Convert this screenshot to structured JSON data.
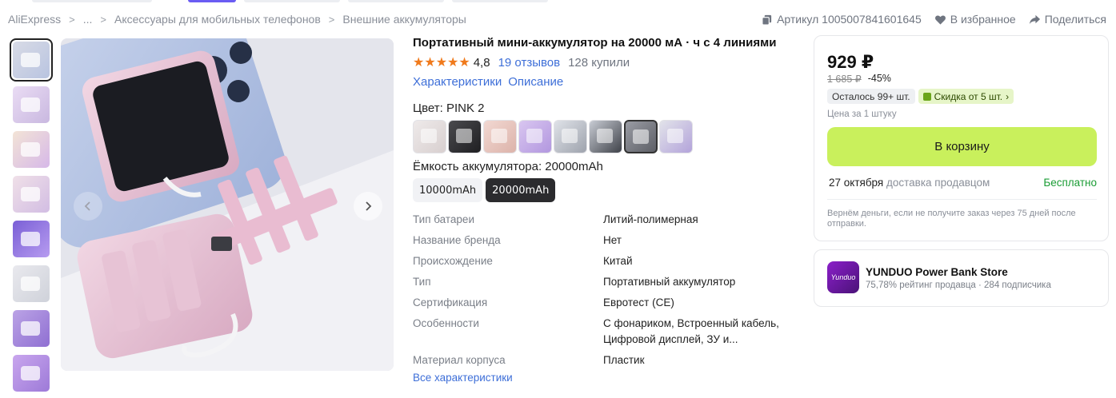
{
  "breadcrumb": {
    "items": [
      "AliExpress",
      "...",
      "Аксессуары для мобильных телефонов",
      "Внешние аккумуляторы"
    ],
    "separator": ">"
  },
  "top_actions": {
    "sku": "Артикул 1005007841601645",
    "favorite": "В избранное",
    "share": "Поделиться"
  },
  "gallery": {
    "thumbnail_count": 8,
    "selected_index": 0,
    "prev_icon": "chevron-left-icon",
    "next_icon": "chevron-right-icon"
  },
  "product": {
    "title": "Портативный мини-аккумулятор на 20000 мА · ч с 4 линиями",
    "stars": "★★★★★",
    "rating": "4,8",
    "reviews": "19 отзывов",
    "bought": "128 купили",
    "tab_specs": "Характеристики",
    "tab_description": "Описание",
    "color_label": "Цвет: PINK 2",
    "color_swatch_count": 8,
    "color_selected_index": 6,
    "capacity_label": "Ёмкость аккумулятора: 20000mAh",
    "capacities": [
      "10000mAh",
      "20000mAh"
    ],
    "capacity_selected": "20000mAh"
  },
  "specs": [
    {
      "key": "Тип батареи",
      "value": "Литий-полимерная"
    },
    {
      "key": "Название бренда",
      "value": "Нет"
    },
    {
      "key": "Происхождение",
      "value": "Китай"
    },
    {
      "key": "Тип",
      "value": "Портативный аккумулятор"
    },
    {
      "key": "Сертификация",
      "value": "Евротест (CE)"
    },
    {
      "key": "Особенности",
      "value": "С фонариком, Встроенный кабель, Цифровой дисплей, ЗУ и..."
    },
    {
      "key": "Материал корпуса",
      "value": "Пластик"
    }
  ],
  "all_specs_link": "Все характеристики",
  "buy_box": {
    "price": "929 ₽",
    "old_price": "1 685 ₽",
    "discount": "-45%",
    "stock": "Осталось 99+ шт.",
    "bulk_discount": "Скидка от 5 шт.",
    "per_piece": "Цена за 1 штуку",
    "cart_button": "В корзину",
    "delivery_date": "27 октября",
    "delivery_by": "доставка продавцом",
    "delivery_price": "Бесплатно",
    "refund_note": "Вернём деньги, если не получите заказ через 75 дней после отправки."
  },
  "store": {
    "logo_text": "Yunduo",
    "name": "YUNDUO Power Bank Store",
    "meta": "75,78% рейтинг продавца · 284 подписчика"
  },
  "colors": {
    "accent_green": "#c9f05c",
    "link_blue": "#3e6fd8",
    "star_orange": "#f07a1c",
    "free_green": "#1a9c34",
    "product_pink": "#e9c6d8"
  }
}
